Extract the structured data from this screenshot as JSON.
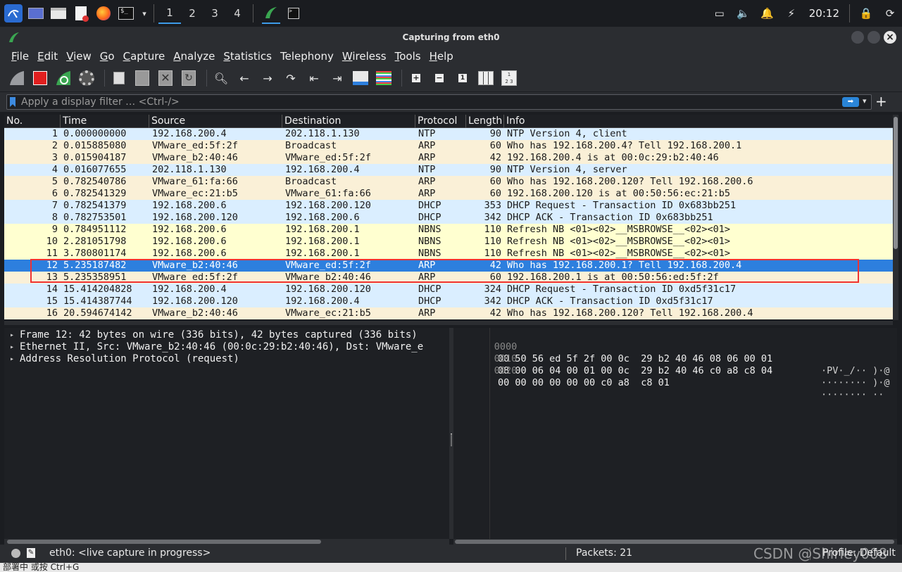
{
  "taskbar": {
    "workspaces": [
      "1",
      "2",
      "3",
      "4"
    ],
    "clock": "20:12",
    "icons": [
      "kali-menu-icon",
      "desktop-icon",
      "folder-icon",
      "text-editor-icon",
      "firefox-icon",
      "terminal-icon",
      "chevron-down-icon",
      "wireshark-icon",
      "terminal-icon"
    ]
  },
  "window": {
    "title": "Capturing from eth0"
  },
  "menu": [
    {
      "first": "F",
      "rest": "ile"
    },
    {
      "first": "E",
      "rest": "dit"
    },
    {
      "first": "V",
      "rest": "iew"
    },
    {
      "first": "G",
      "rest": "o"
    },
    {
      "first": "C",
      "rest": "apture"
    },
    {
      "first": "A",
      "rest": "nalyze"
    },
    {
      "first": "S",
      "rest": "tatistics"
    },
    {
      "first": "Tele",
      "rest": "phony"
    },
    {
      "first": "W",
      "rest": "ireless"
    },
    {
      "first": "T",
      "rest": "ools"
    },
    {
      "first": "H",
      "rest": "elp"
    }
  ],
  "filter": {
    "placeholder": "Apply a display filter … <Ctrl-/>"
  },
  "columns": [
    "No.",
    "Time",
    "Source",
    "Destination",
    "Protocol",
    "Length",
    "Info"
  ],
  "packets": [
    {
      "no": "1",
      "time": "0.000000000",
      "src": "192.168.200.4",
      "dst": "202.118.1.130",
      "proto": "NTP",
      "len": "90",
      "info": "NTP Version 4, client",
      "cls": "bg-udp"
    },
    {
      "no": "2",
      "time": "0.015885080",
      "src": "VMware_ed:5f:2f",
      "dst": "Broadcast",
      "proto": "ARP",
      "len": "60",
      "info": "Who has 192.168.200.4? Tell 192.168.200.1",
      "cls": "bg-arp"
    },
    {
      "no": "3",
      "time": "0.015904187",
      "src": "VMware_b2:40:46",
      "dst": "VMware_ed:5f:2f",
      "proto": "ARP",
      "len": "42",
      "info": "192.168.200.4 is at 00:0c:29:b2:40:46",
      "cls": "bg-arp"
    },
    {
      "no": "4",
      "time": "0.016077655",
      "src": "202.118.1.130",
      "dst": "192.168.200.4",
      "proto": "NTP",
      "len": "90",
      "info": "NTP Version 4, server",
      "cls": "bg-udp"
    },
    {
      "no": "5",
      "time": "0.782540786",
      "src": "VMware_61:fa:66",
      "dst": "Broadcast",
      "proto": "ARP",
      "len": "60",
      "info": "Who has 192.168.200.120? Tell 192.168.200.6",
      "cls": "bg-arp"
    },
    {
      "no": "6",
      "time": "0.782541329",
      "src": "VMware_ec:21:b5",
      "dst": "VMware_61:fa:66",
      "proto": "ARP",
      "len": "60",
      "info": "192.168.200.120 is at 00:50:56:ec:21:b5",
      "cls": "bg-arp"
    },
    {
      "no": "7",
      "time": "0.782541379",
      "src": "192.168.200.6",
      "dst": "192.168.200.120",
      "proto": "DHCP",
      "len": "353",
      "info": "DHCP Request  - Transaction ID 0x683bb251",
      "cls": "bg-udp"
    },
    {
      "no": "8",
      "time": "0.782753501",
      "src": "192.168.200.120",
      "dst": "192.168.200.6",
      "proto": "DHCP",
      "len": "342",
      "info": "DHCP ACK      - Transaction ID 0x683bb251",
      "cls": "bg-udp"
    },
    {
      "no": "9",
      "time": "0.784951112",
      "src": "192.168.200.6",
      "dst": "192.168.200.1",
      "proto": "NBNS",
      "len": "110",
      "info": "Refresh NB <01><02>__MSBROWSE__<02><01>",
      "cls": "bg-nbns"
    },
    {
      "no": "10",
      "time": "2.281051798",
      "src": "192.168.200.6",
      "dst": "192.168.200.1",
      "proto": "NBNS",
      "len": "110",
      "info": "Refresh NB <01><02>__MSBROWSE__<02><01>",
      "cls": "bg-nbns"
    },
    {
      "no": "11",
      "time": "3.780801174",
      "src": "192.168.200.6",
      "dst": "192.168.200.1",
      "proto": "NBNS",
      "len": "110",
      "info": "Refresh NB <01><02>__MSBROWSE__<02><01>",
      "cls": "bg-nbns"
    },
    {
      "no": "12",
      "time": "5.235187482",
      "src": "VMware_b2:40:46",
      "dst": "VMware_ed:5f:2f",
      "proto": "ARP",
      "len": "42",
      "info": "Who has 192.168.200.1? Tell 192.168.200.4",
      "cls": "bg-sel"
    },
    {
      "no": "13",
      "time": "5.235358951",
      "src": "VMware_ed:5f:2f",
      "dst": "VMware_b2:40:46",
      "proto": "ARP",
      "len": "60",
      "info": "192.168.200.1 is at 00:50:56:ed:5f:2f",
      "cls": "bg-arp"
    },
    {
      "no": "14",
      "time": "15.414204828",
      "src": "192.168.200.4",
      "dst": "192.168.200.120",
      "proto": "DHCP",
      "len": "324",
      "info": "DHCP Request  - Transaction ID 0xd5f31c17",
      "cls": "bg-udp"
    },
    {
      "no": "15",
      "time": "15.414387744",
      "src": "192.168.200.120",
      "dst": "192.168.200.4",
      "proto": "DHCP",
      "len": "342",
      "info": "DHCP ACK      - Transaction ID 0xd5f31c17",
      "cls": "bg-udp"
    },
    {
      "no": "16",
      "time": "20.594674142",
      "src": "VMware_b2:40:46",
      "dst": "VMware_ec:21:b5",
      "proto": "ARP",
      "len": "42",
      "info": "Who has 192.168.200.120? Tell 192.168.200.4",
      "cls": "bg-arp"
    }
  ],
  "details": [
    "Frame 12: 42 bytes on wire (336 bits), 42 bytes captured (336 bits)",
    "Ethernet II, Src: VMware_b2:40:46 (00:0c:29:b2:40:46), Dst: VMware_e",
    "Address Resolution Protocol (request)"
  ],
  "bytes": [
    {
      "off": "0000",
      "hex": "00 50 56 ed 5f 2f 00 0c  29 b2 40 46 08 06 00 01",
      "ascii": "·PV·_/·· )·@"
    },
    {
      "off": "0010",
      "hex": "08 00 06 04 00 01 00 0c  29 b2 40 46 c0 a8 c8 04",
      "ascii": "········ )·@"
    },
    {
      "off": "0020",
      "hex": "00 00 00 00 00 00 c0 a8  c8 01",
      "ascii": "········ ··"
    }
  ],
  "status": {
    "capture": "eth0: <live capture in progress>",
    "packets": "Packets: 21",
    "profile": "Profile: Default",
    "watermark": "CSDN @Shirley008"
  },
  "bottom_strip": {
    "text": "部署中 或按 Ctrl+G"
  }
}
